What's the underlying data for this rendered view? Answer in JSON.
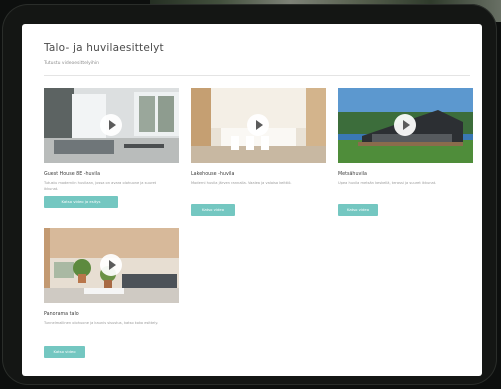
{
  "header": {
    "title": "Talo- ja huvilaesittelyt",
    "subtitle": "Tutustu videoesittelyihin"
  },
  "cards": [
    {
      "title": "Guest House 8E -huvila",
      "description": "Tutustu moderniin huvilaan, jossa on avara olohuone ja suuret ikkunat.",
      "button": "Katso video ja esitys"
    },
    {
      "title": "Lakehouse -huvila",
      "description": "Moderni huvila järven rannalla. Vaalea ja valoisa keittiö.",
      "button": "Katso video"
    },
    {
      "title": "Metsähuvila",
      "description": "Upea huvila metsän keskellä, terassi ja suuret ikkunat.",
      "button": "Katso video"
    },
    {
      "title": "Panorama talo",
      "description": "Tunnelmallinen olohuone ja kaunis sisustus, katso koko esittely.",
      "button": "Katso video"
    }
  ],
  "colors": {
    "accent": "#74c7c1",
    "frame": "#141614"
  },
  "icons": {
    "play": "play-icon"
  }
}
